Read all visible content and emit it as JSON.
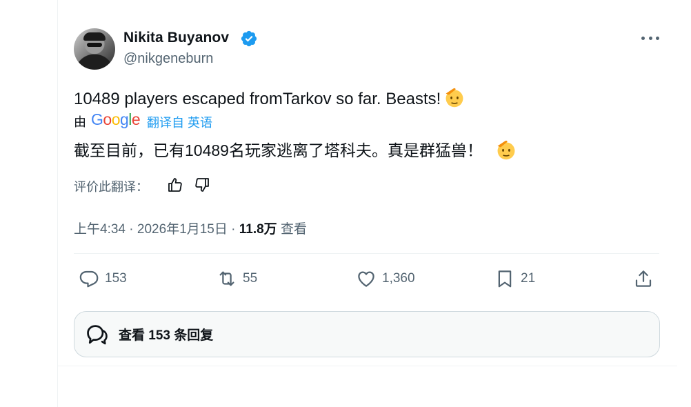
{
  "author": {
    "name": "Nikita Buyanov",
    "handle": "@nikgeneburn",
    "verified_color": "#1d9bf0"
  },
  "tweet": {
    "text": "10489 players escaped fromTarkov so far. Beasts!",
    "emoji": "saluting-face-icon"
  },
  "translation": {
    "by_label": "由",
    "provider": "Google",
    "from_label": "翻译自 英语",
    "text": "截至目前，已有10489名玩家逃离了塔科夫。真是群猛兽！",
    "rate_label": "评价此翻译："
  },
  "meta": {
    "time": "上午4:34",
    "sep1": " · ",
    "date": "2026年1月15日",
    "sep2": " · ",
    "views": "11.8万",
    "views_label": " 查看"
  },
  "actions": {
    "reply_count": "153",
    "retweet_count": "55",
    "like_count": "1,360",
    "bookmark_count": "21"
  },
  "replies_button": {
    "label": "查看 153 条回复"
  },
  "colors": {
    "text": "#0f1419",
    "secondary": "#536471",
    "accent": "#1d9bf0"
  }
}
